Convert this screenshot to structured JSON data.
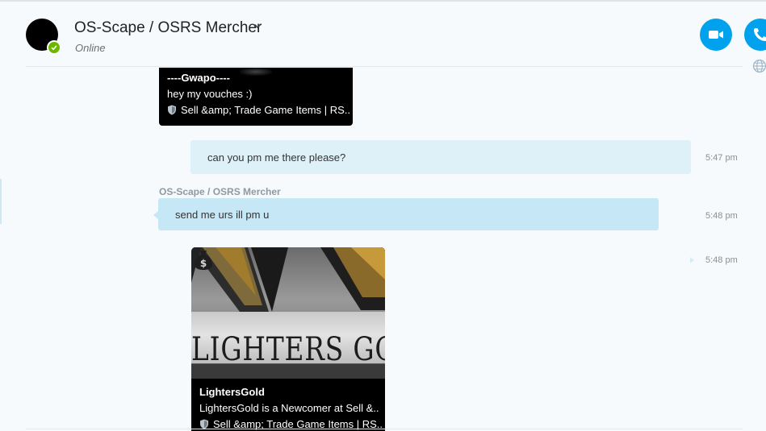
{
  "header": {
    "title": "OS-Scape / OSRS Mercher",
    "status": "Online"
  },
  "colors": {
    "accent": "#00a2ed",
    "presence_online": "#6bb700",
    "outgoing_bubble": "#dff1f8",
    "incoming_bubble": "#c6e7f6"
  },
  "messages": {
    "card1": {
      "title": "----Gwapo----",
      "description": "hey my vouches :)",
      "site": "Sell &amp; Trade Game Items | RS.."
    },
    "outgoing_1": {
      "text": "can you pm me there please?",
      "time": "5:47 pm"
    },
    "incoming_1": {
      "sender": "OS-Scape / OSRS Mercher",
      "text": "send me urs ill pm u",
      "time": "5:48 pm"
    },
    "card2": {
      "time": "5:48 pm",
      "image_text": "LIGHTERS GOLD",
      "title": "LightersGold",
      "description": "LightersGold is a Newcomer at Sell &..",
      "site": "Sell &amp; Trade Game Items | RS.."
    }
  },
  "icons": {
    "video": "video-camera-icon",
    "audio": "phone-icon",
    "globe": "globe-icon",
    "chevron": "chevron-down-icon",
    "shield": "shield-icon"
  }
}
